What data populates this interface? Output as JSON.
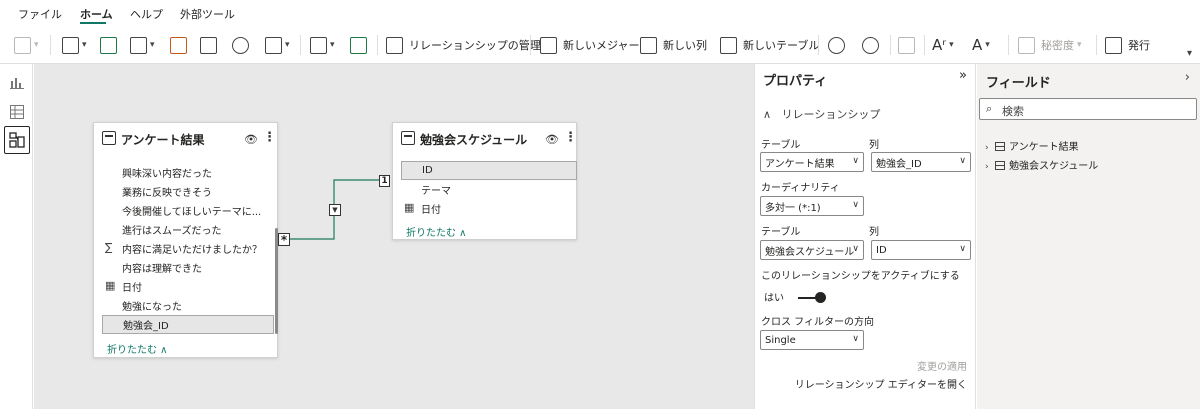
{
  "menu": {
    "items": [
      "ファイル",
      "ホーム",
      "ヘルプ",
      "外部ツール"
    ],
    "active_index": 1
  },
  "ribbon": {
    "manage_relationships": "リレーションシップの管理",
    "new_measure": "新しいメジャー",
    "new_column": "新しい列",
    "new_table": "新しいテーブル",
    "sensitivity": "秘密度",
    "publish": "発行"
  },
  "rail": {
    "items": [
      "report-view",
      "data-view",
      "model-view"
    ],
    "active": "model-view"
  },
  "model": {
    "table1": {
      "title": "アンケート結果",
      "fields": [
        {
          "name": "興味深い内容だった",
          "icon": ""
        },
        {
          "name": "業務に反映できそう",
          "icon": ""
        },
        {
          "name": "今後開催してほしいテーマに...",
          "icon": ""
        },
        {
          "name": "進行はスムーズだった",
          "icon": ""
        },
        {
          "name": "内容に満足いただけましたか？",
          "icon": "sigma"
        },
        {
          "name": "内容は理解できた",
          "icon": ""
        },
        {
          "name": "日付",
          "icon": "calendar"
        },
        {
          "name": "勉強になった",
          "icon": ""
        },
        {
          "name": "勉強会_ID",
          "icon": "",
          "selected": true
        }
      ],
      "collapse_label": "折りたたむ ∧"
    },
    "table2": {
      "title": "勉強会スケジュール",
      "fields": [
        {
          "name": "ID",
          "icon": "",
          "selected": true
        },
        {
          "name": "テーマ",
          "icon": ""
        },
        {
          "name": "日付",
          "icon": "calendar"
        }
      ],
      "collapse_label": "折りたたむ ∧"
    },
    "relationship": {
      "many_marker": "*",
      "one_marker": "1",
      "filter_direction_marker": "▼"
    }
  },
  "properties": {
    "title": "プロパティ",
    "collapse_glyph": "»",
    "section": "リレーションシップ",
    "table_label": "テーブル",
    "column_label": "列",
    "table1_value": "アンケート結果",
    "column1_value": "勉強会_ID",
    "cardinality_label": "カーディナリティ",
    "cardinality_value": "多対一 (*:1)",
    "table2_value": "勉強会スケジュール",
    "column2_value": "ID",
    "active_label": "このリレーションシップをアクティブにする",
    "active_value": "はい",
    "cross_filter_label": "クロス フィルターの方向",
    "cross_filter_value": "Single",
    "apply_changes": "変更の適用",
    "open_editor": "リレーションシップ エディターを開く"
  },
  "fields_pane": {
    "title": "フィールド",
    "search_placeholder": "検索",
    "tables": [
      "アンケート結果",
      "勉強会スケジュール"
    ]
  }
}
